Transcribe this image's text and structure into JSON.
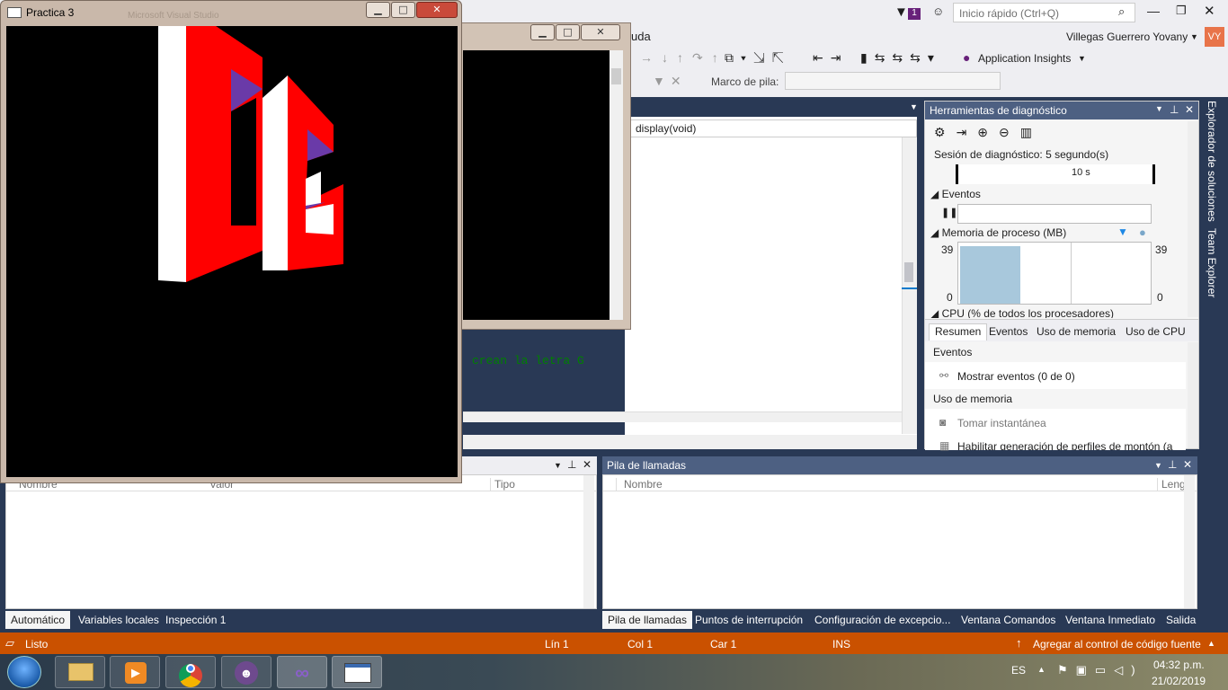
{
  "vs": {
    "notification_count": "1",
    "quick_launch_placeholder": "Inicio rápido (Ctrl+Q)",
    "user_name": "Villegas Guerrero Yovany",
    "user_initials": "VY",
    "menu_partial": "uda",
    "app_insights": "Application Insights",
    "stack_frame_label": "Marco de pila:",
    "function_dropdown": "display(void)",
    "code_comment": "crean la letra G"
  },
  "diagnostics": {
    "title": "Herramientas de diagnóstico",
    "session": "Sesión de diagnóstico: 5 segundo(s)",
    "timeline_label": "10 s",
    "events_section": "Eventos",
    "memory_section": "Memoria de proceso (MB)",
    "memory_max_left": "39",
    "memory_min_left": "0",
    "memory_max_right": "39",
    "memory_min_right": "0",
    "memory_fill": 0.58,
    "cpu_section": "CPU (% de todos los procesadores)",
    "tabs": [
      "Resumen",
      "Eventos",
      "Uso de memoria",
      "Uso de CPU"
    ],
    "summary_events_header": "Eventos",
    "show_events": "Mostrar eventos (0 de 0)",
    "memory_usage_header": "Uso de memoria",
    "take_snapshot": "Tomar instantánea",
    "heap_profiling": "Habilitar generación de perfiles de montón (a"
  },
  "side_tabs": [
    "Explorador de soluciones",
    "Team Explorer"
  ],
  "autos_pane": {
    "columns": [
      "Nombre",
      "Valor",
      "Tipo"
    ],
    "tabs": [
      "Automático",
      "Variables locales",
      "Inspección 1"
    ]
  },
  "callstack_pane": {
    "title": "Pila de llamadas",
    "columns": [
      "Nombre",
      "Leng"
    ],
    "tabs": [
      "Pila de llamadas",
      "Puntos de interrupción",
      "Configuración de excepcio...",
      "Ventana Comandos",
      "Ventana Inmediato",
      "Salida"
    ]
  },
  "status": {
    "ready": "Listo",
    "line": "Lín 1",
    "col": "Col 1",
    "char": "Car 1",
    "mode": "INS",
    "source_control": "Agregar al control de código fuente"
  },
  "glut_window": {
    "title": "Practica 3",
    "faded_title": "Microsoft Visual Studio"
  },
  "taskbar": {
    "language": "ES",
    "time": "04:32 p.m.",
    "date": "21/02/2019"
  },
  "colors": {
    "vs_status": "#ca5100",
    "letter_red": "#ff0000",
    "letter_white": "#ffffff",
    "letter_purple": "#6a3aa8"
  }
}
